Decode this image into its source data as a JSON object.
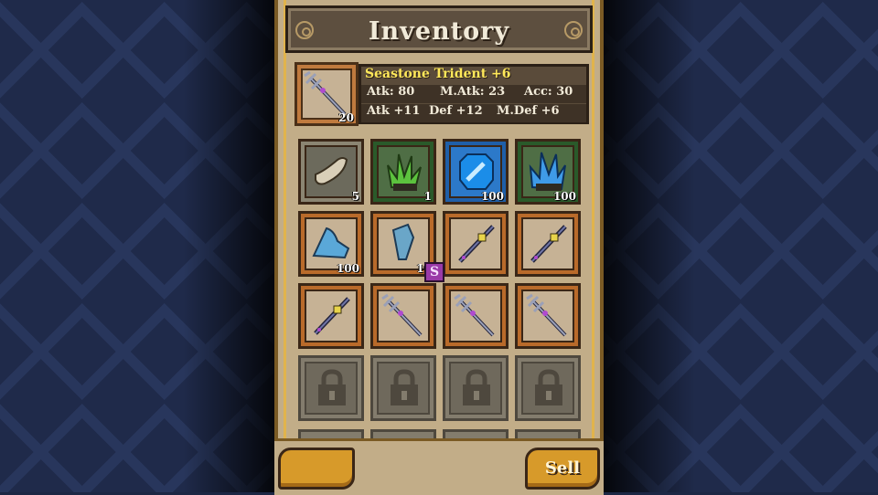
{
  "header": {
    "title": "Inventory"
  },
  "selected": {
    "name": "Seastone Trident +6",
    "count": "20",
    "icon": "trident-icon",
    "stats": [
      {
        "label": "Atk: 80"
      },
      {
        "label": "M.Atk: 23"
      },
      {
        "label": "Acc: 30"
      }
    ],
    "bonuses": [
      {
        "label": "Atk +11"
      },
      {
        "label": "Def +12"
      },
      {
        "label": "M.Def +6"
      }
    ]
  },
  "slots": [
    {
      "icon": "bone-horn-icon",
      "count": "5",
      "style": "grey"
    },
    {
      "icon": "green-crystal-icon",
      "count": "1",
      "style": "green"
    },
    {
      "icon": "blue-gem-icon",
      "count": "100",
      "style": "blue"
    },
    {
      "icon": "blue-crystal-icon",
      "count": "100",
      "style": "green"
    },
    {
      "icon": "blue-shard-icon",
      "count": "100",
      "style": "orange"
    },
    {
      "icon": "blue-feather-icon",
      "count": "10",
      "style": "orange"
    },
    {
      "icon": "staff-icon",
      "count": "",
      "style": "orange"
    },
    {
      "icon": "staff-icon",
      "count": "",
      "style": "orange"
    },
    {
      "icon": "staff-icon",
      "count": "",
      "style": "orange"
    },
    {
      "icon": "trident-icon",
      "count": "",
      "style": "orange"
    },
    {
      "icon": "trident-icon",
      "count": "",
      "style": "orange"
    },
    {
      "icon": "trident-icon",
      "count": "",
      "style": "orange"
    },
    {
      "icon": "lock-icon",
      "count": "",
      "style": "locked"
    },
    {
      "icon": "lock-icon",
      "count": "",
      "style": "locked"
    },
    {
      "icon": "lock-icon",
      "count": "",
      "style": "locked"
    },
    {
      "icon": "lock-icon",
      "count": "",
      "style": "locked"
    }
  ],
  "badge": "S",
  "buttons": {
    "left_label": "",
    "sell_label": "Sell"
  },
  "colors": {
    "name": "#ffe85a",
    "panel": "#c2ad88",
    "button": "#d79a2a"
  }
}
